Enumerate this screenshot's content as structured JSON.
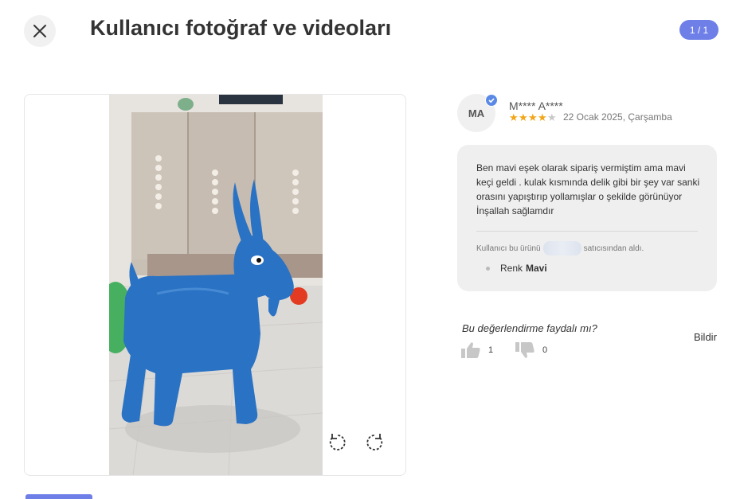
{
  "header": {
    "title": "Kullanıcı fotoğraf ve videoları",
    "counter": "1 / 1"
  },
  "icons": {
    "close": "close-icon",
    "rotate_left": "rotate-left-icon",
    "rotate_right": "rotate-right-icon",
    "verified": "verified-check-icon",
    "thumbs_up": "thumbs-up-icon",
    "thumbs_down": "thumbs-down-icon"
  },
  "review": {
    "avatar_initials": "MA",
    "user_name": "M**** A****",
    "rating": 4,
    "rating_max": 5,
    "date": "22 Ocak 2025, Çarşamba",
    "text": "Ben mavi eşek olarak sipariş vermiştim ama mavi keçi geldi .  kulak kısmında delik gibi bir şey var sanki orasını yapıştırıp yollamışlar o şekilde görünüyor İnşallah sağlamdır",
    "seller_prefix": "Kullanıcı bu ürünü",
    "seller_suffix": "satıcısından aldı.",
    "attribute_label": "Renk",
    "attribute_value": "Mavi"
  },
  "feedback": {
    "question": "Bu değerlendirme faydalı mı?",
    "likes": "1",
    "dislikes": "0",
    "report_label": "Bildir"
  },
  "colors": {
    "accent": "#6f7fe8",
    "star_filled": "#f2a516",
    "star_empty": "#c8c8c8",
    "verified": "#5a8ae6"
  }
}
